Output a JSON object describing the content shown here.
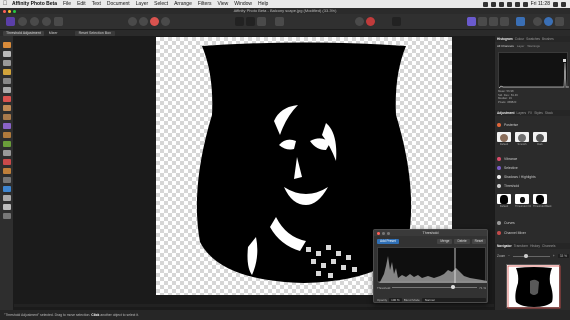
{
  "menubar": {
    "app_name": "Affinity Photo Beta",
    "items": [
      "File",
      "Edit",
      "Text",
      "Document",
      "Layer",
      "Select",
      "Arrange",
      "Filters",
      "View",
      "Window",
      "Help"
    ],
    "clock": "Fri 11:28"
  },
  "window": {
    "title": "Affinity Photo Beta - Balcony scape.jpg (Modified) (33.3%)"
  },
  "context_bar": {
    "tabs": [
      "Threshold Adjustment",
      "Mixer"
    ],
    "button": "Reset Selection Box"
  },
  "right_panel": {
    "top_tabs": [
      "Histogram",
      "Colour",
      "Swatches",
      "Brushes"
    ],
    "sub_tabs": [
      "All Channels",
      "Layer",
      "Warnings"
    ],
    "histogram_stats": [
      "Mean: 56.98",
      "Std. Dev.: 81.46",
      "Median: 19",
      "Pixels: 458820"
    ],
    "adjust_tabs": [
      "Adjustment",
      "Layers",
      "FX",
      "Styles",
      "Stock"
    ],
    "adjustments": [
      "Posterise",
      "Vibrance",
      "Selective",
      "Shadows / Highlights",
      "Threshold",
      "Curves",
      "Channel Mixer"
    ],
    "posterise_presets": [
      "Default",
      "Smooth",
      "Dark"
    ],
    "threshold_presets": [
      "Default",
      "Threshold 1%",
      "Threshold Black"
    ],
    "nav_tabs": [
      "Navigator",
      "Transform",
      "History",
      "Channels"
    ],
    "zoom_label": "Zoom",
    "zoom_value": "33 %"
  },
  "threshold_dialog": {
    "title": "Threshold",
    "add_preset": "Add Preset",
    "merge": "Merge",
    "delete": "Delete",
    "reset": "Reset",
    "threshold_label": "Threshold",
    "threshold_value": "71 %",
    "threshold_fraction": 0.71,
    "opacity_label": "Opacity",
    "opacity_value": "100 %",
    "blend_label": "Blend Mode",
    "blend_value": "Normal"
  },
  "status": {
    "prefix": "\"Threshold Adjustment\" selected.",
    "middle": "Drag to move selection.",
    "click": "Click",
    "suffix": "another object to select it."
  },
  "colors": {
    "accent": "#2f6fb5",
    "posterise": "#e0663a",
    "vibrance": "#d94b6a",
    "selective": "#7a5cc7",
    "shadows": "#eeeeee",
    "threshold": "#cccccc",
    "curves": "#9a9a9a",
    "channel_mixer": "#c44b4b"
  }
}
